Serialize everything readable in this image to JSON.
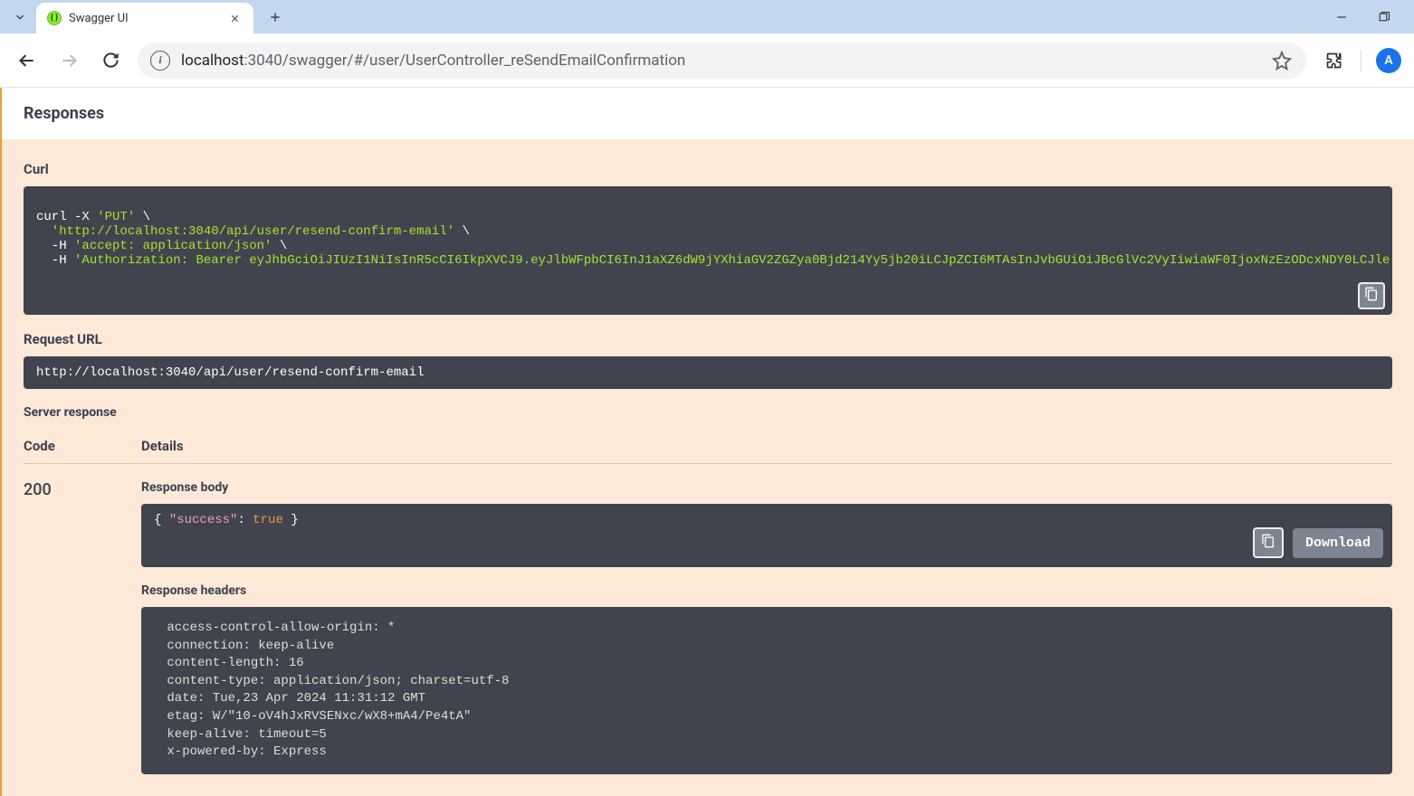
{
  "browser": {
    "tab_title": "Swagger UI",
    "url_host": "localhost",
    "url_port_path": ":3040/swagger/#/user/UserController_reSendEmailConfirmation",
    "profile_initial": "A"
  },
  "swagger": {
    "responses_title": "Responses",
    "curl_label": "Curl",
    "curl_line1_cmd": "curl -X ",
    "curl_line1_str": "'PUT'",
    "curl_line1_bs": " \\",
    "curl_line2_str": "  'http://localhost:3040/api/user/resend-confirm-email'",
    "curl_line2_bs": " \\",
    "curl_line3_flag": "  -H ",
    "curl_line3_str": "'accept: application/json'",
    "curl_line3_bs": " \\",
    "curl_line4_flag": "  -H ",
    "curl_line4_str": "'Authorization: Bearer eyJhbGciOiJIUzI1NiIsInR5cCI6IkpXVCJ9.eyJlbWFpbCI6InJ1aXZ6dW9jYXhiaGV2ZGZya0Bjd214Yy5jb20iLCJpZCI6MTAsInJvbGUiOiJBcGlVc2VyIiwiaWF0IjoxNzEzODcxNDY0LCJle",
    "request_url_label": "Request URL",
    "request_url": "http://localhost:3040/api/user/resend-confirm-email",
    "server_response_label": "Server response",
    "th_code": "Code",
    "th_details": "Details",
    "status_code": "200",
    "response_body_label": "Response body",
    "rb_open": "{",
    "rb_key": "\"success\"",
    "rb_colon": ": ",
    "rb_val": "true",
    "rb_close": "}",
    "download_label": "Download",
    "response_headers_label": "Response headers",
    "headers_text": " access-control-allow-origin: * \n connection: keep-alive \n content-length: 16 \n content-type: application/json; charset=utf-8 \n date: Tue,23 Apr 2024 11:31:12 GMT \n etag: W/\"10-oV4hJxRVSENxc/wX8+mA4/Pe4tA\" \n keep-alive: timeout=5 \n x-powered-by: Express "
  }
}
